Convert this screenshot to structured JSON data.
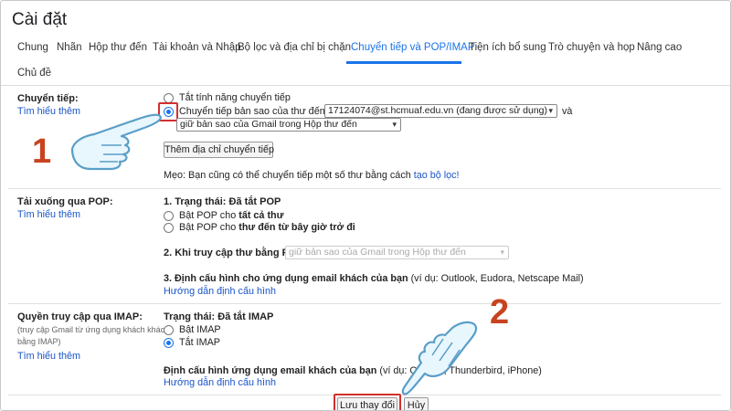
{
  "page": {
    "title": "Cài đặt"
  },
  "tabs": [
    {
      "label": "Chung"
    },
    {
      "label": "Nhãn"
    },
    {
      "label": "Hộp thư đến"
    },
    {
      "label": "Tài khoản và Nhập"
    },
    {
      "label": "Bộ lọc và địa chỉ bị chặn"
    },
    {
      "label": "Chuyển tiếp và POP/IMAP",
      "active": true
    },
    {
      "label": "Tiện ích bổ sung"
    },
    {
      "label": "Trò chuyện và họp"
    },
    {
      "label": "Nâng cao"
    },
    {
      "label": "Chủ đề"
    }
  ],
  "forwarding": {
    "label": "Chuyển tiếp:",
    "learn_more": "Tìm hiểu thêm",
    "option_off": "Tắt tính năng chuyển tiếp",
    "option_forward": "Chuyển tiếp bản sao của thư đến tới",
    "forward_address": "17124074@st.hcmuaf.edu.vn (đang được sử dụng)",
    "and_text": "và",
    "keep_copy": "giữ bản sao của Gmail trong Hộp thư đến",
    "add_button": "Thêm địa chỉ chuyển tiếp",
    "tip_text": "Mẹo: Bạn cũng có thể chuyển tiếp một số thư bằng cách",
    "tip_link": "tạo bộ lọc!"
  },
  "pop": {
    "label": "Tải xuống qua POP:",
    "learn_more": "Tìm hiểu thêm",
    "status": "1. Trạng thái: Đã tắt POP",
    "opt_all_prefix": "Bật POP cho ",
    "opt_all_bold": "tất cả thư",
    "opt_now_prefix": "Bật POP cho ",
    "opt_now_bold": "thư đến từ bây giờ trở đi",
    "when_access": "2. Khi truy cập thư bằng POP",
    "when_access_value": "giữ bản sao của Gmail trong Hộp thư đến",
    "configure": "3. Định cấu hình cho ứng dụng email khách của bạn",
    "configure_note": "(ví dụ: Outlook, Eudora, Netscape Mail)",
    "config_link": "Hướng dẫn định cấu hình"
  },
  "imap": {
    "label": "Quyền truy cập qua IMAP:",
    "sub1": "(truy cập Gmail từ ứng dụng khách khác",
    "sub2": "bằng IMAP)",
    "learn_more": "Tìm hiểu thêm",
    "status": "Trạng thái: Đã tắt IMAP",
    "opt_on": "Bật IMAP",
    "opt_off": "Tắt IMAP",
    "configure": "Định cấu hình ứng dụng email khách của bạn",
    "configure_note": "(ví dụ: Outlook, Thunderbird, iPhone)",
    "config_link": "Hướng dẫn định cấu hình"
  },
  "actions": {
    "save": "Lưu thay đổi",
    "cancel": "Hủy"
  },
  "annotations": {
    "step1": "1",
    "step2": "2"
  },
  "colors": {
    "accent": "#1a73e8",
    "link": "#1a55c8",
    "highlight": "#d32f2f",
    "step_number": "#c8431f"
  }
}
